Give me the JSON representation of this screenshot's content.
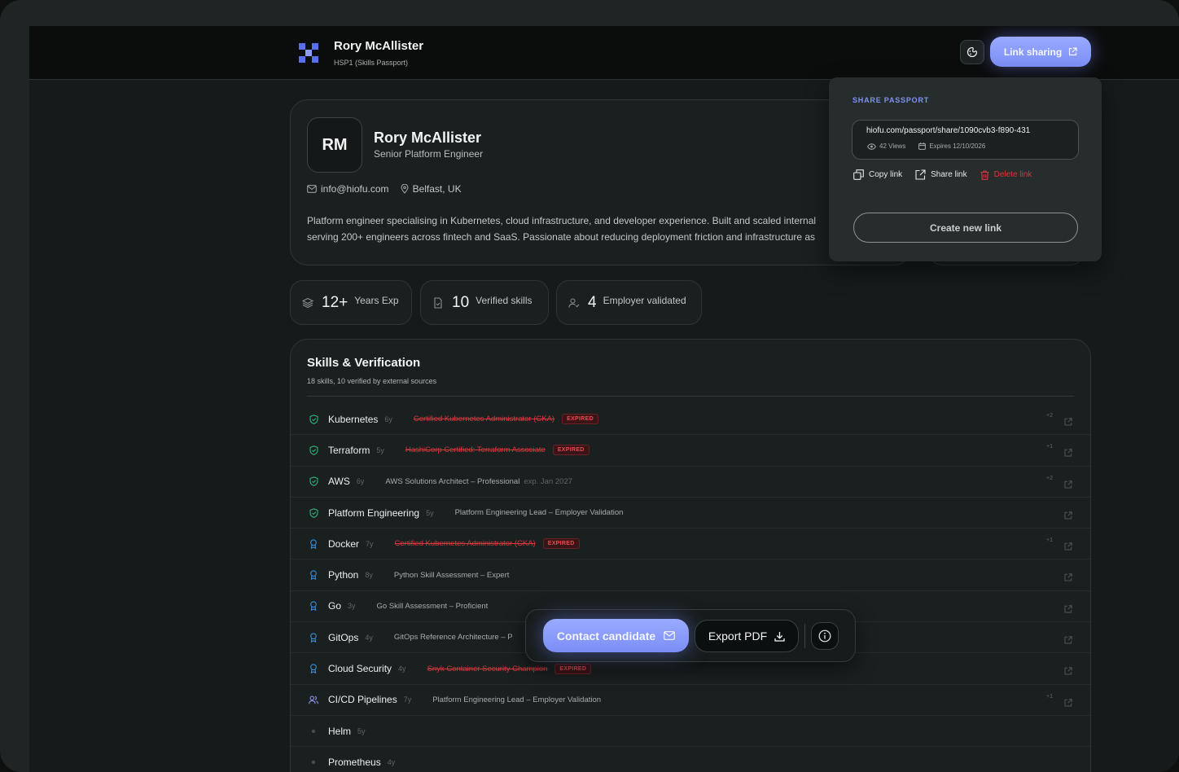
{
  "header": {
    "name": "Rory McAllister",
    "subtitle": "HSP1 (Skills Passport)",
    "link_sharing_label": "Link sharing"
  },
  "profile": {
    "initials": "RM",
    "name": "Rory McAllister",
    "role": "Senior Platform Engineer",
    "email": "info@hiofu.com",
    "location": "Belfast, UK",
    "bio_line1": "Platform engineer specialising in Kubernetes, cloud infrastructure, and developer experience. Built and scaled internal",
    "bio_line2": "serving 200+ engineers across fintech and SaaS. Passionate about reducing deployment friction and infrastructure as"
  },
  "stats": [
    {
      "value": "12+",
      "label": "Years Exp",
      "icon": "layers-icon"
    },
    {
      "value": "10",
      "label": "Verified skills",
      "icon": "document-check-icon"
    },
    {
      "value": "4",
      "label": "Employer validated",
      "icon": "user-check-icon"
    }
  ],
  "skills": {
    "title": "Skills & Verification",
    "subtitle": "18 skills, 10 verified by external sources",
    "rows": [
      {
        "name": "Kubernetes",
        "years": "6y",
        "cert": "Certified Kubernetes Administrator (CKA)",
        "expired": true,
        "badge": "EXPIRED",
        "extra": "",
        "more": "+2",
        "icon": "shield-check-icon",
        "color": "#2fb27a"
      },
      {
        "name": "Terraform",
        "years": "5y",
        "cert": "HashiCorp Certified: Terraform Associate",
        "expired": true,
        "badge": "EXPIRED",
        "extra": "",
        "more": "+1",
        "icon": "shield-check-icon",
        "color": "#2fb27a"
      },
      {
        "name": "AWS",
        "years": "6y",
        "cert": "AWS Solutions Architect – Professional",
        "expired": false,
        "badge": "",
        "extra": "exp. Jan 2027",
        "more": "+2",
        "icon": "shield-check-icon",
        "color": "#2fb27a"
      },
      {
        "name": "Platform Engineering",
        "years": "5y",
        "cert": "Platform Engineering Lead – Employer Validation",
        "expired": false,
        "badge": "",
        "extra": "",
        "more": "",
        "icon": "shield-check-icon",
        "color": "#2fb27a"
      },
      {
        "name": "Docker",
        "years": "7y",
        "cert": "Certified Kubernetes Administrator (CKA)",
        "expired": true,
        "badge": "EXPIRED",
        "extra": "",
        "more": "+1",
        "icon": "award-icon",
        "color": "#3a8fd6"
      },
      {
        "name": "Python",
        "years": "8y",
        "cert": "Python Skill Assessment – Expert",
        "expired": false,
        "badge": "",
        "extra": "",
        "more": "",
        "icon": "award-icon",
        "color": "#3a8fd6"
      },
      {
        "name": "Go",
        "years": "3y",
        "cert": "Go Skill Assessment – Proficient",
        "expired": false,
        "badge": "",
        "extra": "",
        "more": "",
        "icon": "award-icon",
        "color": "#3a8fd6"
      },
      {
        "name": "GitOps",
        "years": "4y",
        "cert": "GitOps Reference Architecture – P",
        "expired": false,
        "badge": "",
        "extra": "",
        "more": "",
        "icon": "award-icon",
        "color": "#3a8fd6"
      },
      {
        "name": "Cloud Security",
        "years": "4y",
        "cert": "Snyk Container Security Champion",
        "expired": true,
        "badge": "EXPIRED",
        "extra": "",
        "more": "",
        "icon": "award-icon",
        "color": "#3a8fd6"
      },
      {
        "name": "CI/CD Pipelines",
        "years": "7y",
        "cert": "Platform Engineering Lead – Employer Validation",
        "expired": false,
        "badge": "",
        "extra": "",
        "more": "+1",
        "icon": "users-icon",
        "color": "#8a95e8"
      },
      {
        "name": "Helm",
        "years": "5y",
        "cert": "",
        "expired": false,
        "badge": "",
        "extra": "",
        "more": "",
        "icon": "dot-icon",
        "color": "#454c4c"
      },
      {
        "name": "Prometheus",
        "years": "4y",
        "cert": "",
        "expired": false,
        "badge": "",
        "extra": "",
        "more": "",
        "icon": "dot-icon",
        "color": "#454c4c"
      }
    ]
  },
  "share": {
    "title": "SHARE PASSPORT",
    "url": "hiofu.com/passport/share/1090cvb3-f890-431",
    "views": "42 Views",
    "expires": "Expires 12/10/2026",
    "copy_label": "Copy link",
    "share_label": "Share link",
    "delete_label": "Delete link",
    "create_label": "Create new link"
  },
  "actions": {
    "contact_label": "Contact candidate",
    "export_label": "Export PDF"
  },
  "colors": {
    "accent": "#8b9cfa",
    "danger": "#d6383d",
    "verified": "#2fb27a",
    "assessed": "#3a8fd6"
  }
}
